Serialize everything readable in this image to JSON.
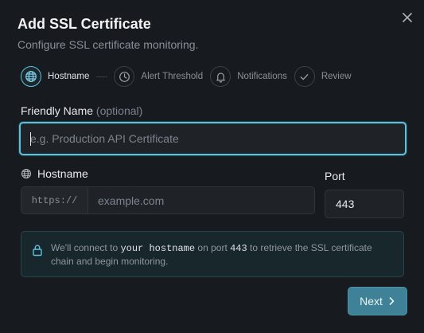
{
  "dialog": {
    "title": "Add SSL Certificate",
    "subtitle": "Configure SSL certificate monitoring."
  },
  "steps": [
    {
      "label": "Hostname",
      "icon": "globe-icon",
      "active": true
    },
    {
      "label": "Alert Threshold",
      "icon": "clock-icon",
      "active": false
    },
    {
      "label": "Notifications",
      "icon": "bell-icon",
      "active": false
    },
    {
      "label": "Review",
      "icon": "check-icon",
      "active": false
    }
  ],
  "form": {
    "friendly_name": {
      "label": "Friendly Name",
      "optional": "(optional)",
      "value": "",
      "placeholder": "e.g. Production API Certificate"
    },
    "hostname": {
      "label": "Hostname",
      "prefix": "https://",
      "value": "",
      "placeholder": "example.com"
    },
    "port": {
      "label": "Port",
      "value": "443"
    }
  },
  "info": {
    "part1": "We'll connect to ",
    "hostname_token": "your hostname",
    "part2": " on port ",
    "port_token": "443",
    "part3": " to retrieve the SSL certificate chain and begin monitoring."
  },
  "actions": {
    "next_label": "Next"
  },
  "colors": {
    "background": "#171a1e",
    "accent": "#58c1dd",
    "button": "#3f8196"
  }
}
